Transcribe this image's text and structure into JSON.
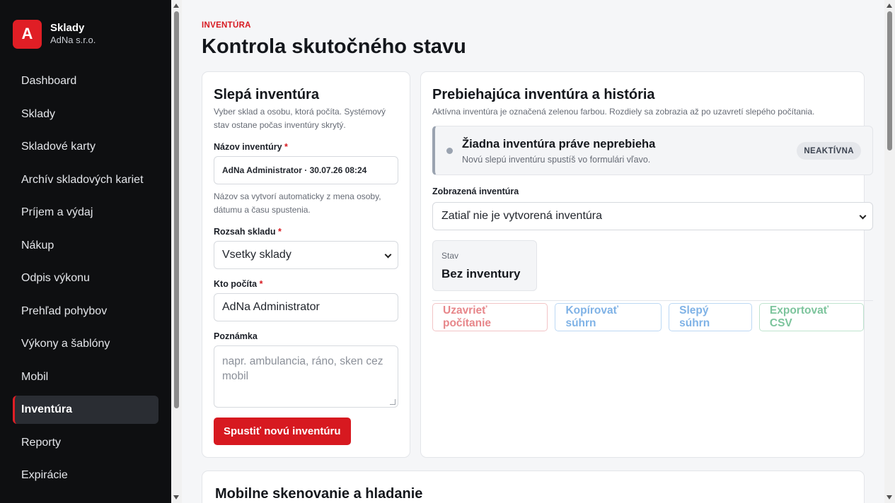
{
  "brand": {
    "logo_letter": "A",
    "title": "Sklady",
    "subtitle": "AdNa s.r.o."
  },
  "sidebar": {
    "items": [
      {
        "label": "Dashboard"
      },
      {
        "label": "Sklady"
      },
      {
        "label": "Skladové karty"
      },
      {
        "label": "Archív skladových kariet"
      },
      {
        "label": "Príjem a výdaj"
      },
      {
        "label": "Nákup"
      },
      {
        "label": "Odpis výkonu"
      },
      {
        "label": "Prehľad pohybov"
      },
      {
        "label": "Výkony a šablóny"
      },
      {
        "label": "Mobil"
      },
      {
        "label": "Inventúra",
        "active": true
      },
      {
        "label": "Reporty"
      },
      {
        "label": "Expirácie"
      }
    ]
  },
  "page": {
    "eyebrow": "INVENTÚRA",
    "title": "Kontrola skutočného stavu"
  },
  "blind": {
    "title": "Slepá inventúra",
    "description": "Vyber sklad a osobu, ktorá počíta. Systémový stav ostane počas inventúry skrytý.",
    "name_label": "Názov inventúry",
    "name_value": "AdNa Administrator · 30.07.26 08:24",
    "name_hint": "Názov sa vytvorí automaticky z mena osoby, dátumu a času spustenia.",
    "scope_label": "Rozsah skladu",
    "scope_value": "Vsetky sklady",
    "counter_label": "Kto počíta",
    "counter_value": "AdNa Administrator",
    "note_label": "Poznámka",
    "note_placeholder": "napr. ambulancia, ráno, sken cez mobil",
    "required_mark": "*",
    "start_button": "Spustiť novú inventúru"
  },
  "running": {
    "title": "Prebiehajúca inventúra a história",
    "description": "Aktívna inventúra je označená zelenou farbou. Rozdiely sa zobrazia až po uzavretí slepého počítania.",
    "status_title": "Žiadna inventúra práve neprebieha",
    "status_sub": "Novú slepú inventúru spustíš vo formulári vľavo.",
    "status_badge": "NEAKTÍVNA",
    "shown_label": "Zobrazená inventúra",
    "shown_value": "Zatiaľ nie je vytvorená inventúra",
    "state_label": "Stav",
    "state_value": "Bez inventury",
    "actions": {
      "close": "Uzavrieť počítanie",
      "copy": "Kopírovať súhrn",
      "blind_summary": "Slepý súhrn",
      "export": "Exportovať CSV"
    }
  },
  "mobile": {
    "title": "Mobilne skenovanie a hladanie"
  },
  "colors": {
    "accent": "#d71920",
    "sidebar_bg": "#0e0f11"
  }
}
